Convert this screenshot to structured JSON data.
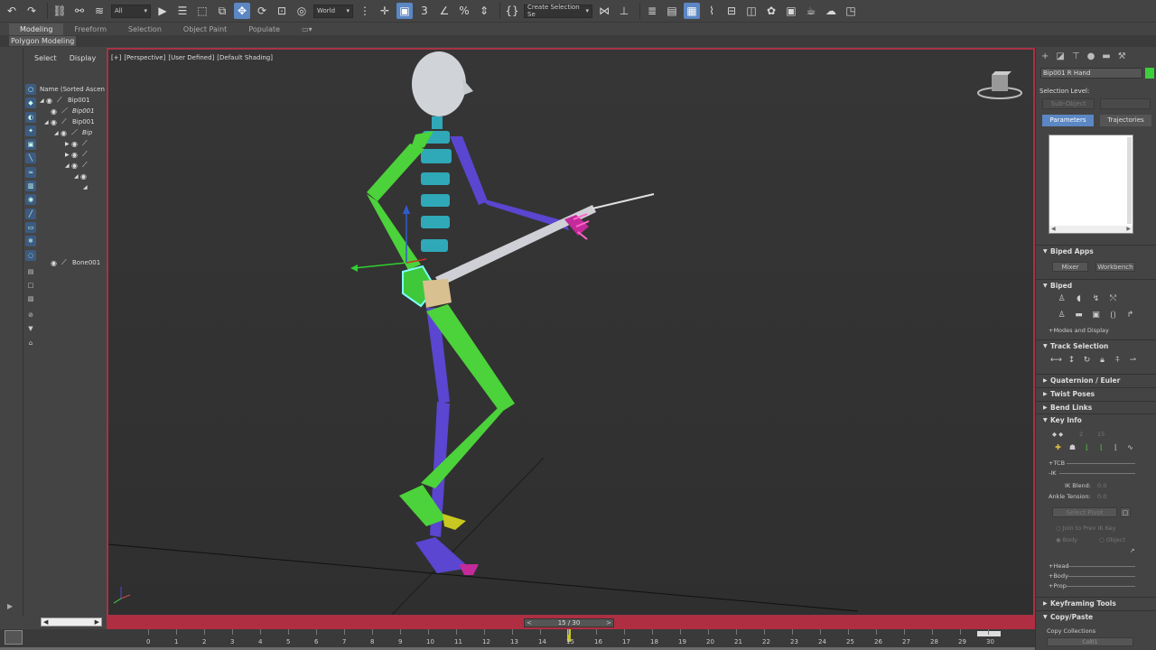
{
  "toolbar": {
    "filter_dropdown": "All",
    "coord_dropdown": "World",
    "selection_set_dropdown": "Create Selection Se"
  },
  "ribbon": {
    "tabs": [
      "Modeling",
      "Freeform",
      "Selection",
      "Object Paint",
      "Populate"
    ],
    "sub_label": "Polygon Modeling"
  },
  "explorer": {
    "tabs": [
      "Select",
      "Display"
    ],
    "header": "Name (Sorted Ascen",
    "items": [
      {
        "label": "Bip001",
        "italic": false
      },
      {
        "label": "Bip001",
        "italic": true
      },
      {
        "label": "Bip001",
        "italic": false
      },
      {
        "label": "Bip",
        "italic": true
      },
      {
        "label": "",
        "italic": false
      },
      {
        "label": "",
        "italic": false
      },
      {
        "label": "",
        "italic": false
      },
      {
        "label": "",
        "italic": false
      },
      {
        "label": "",
        "italic": false
      }
    ],
    "extra_item": "Bone001"
  },
  "viewport": {
    "label_parts": [
      "[+]",
      "[Perspective]",
      "[User Defined]",
      "[Default Shading]"
    ]
  },
  "timeline": {
    "frame_display": "15 / 30",
    "ticks": [
      "0",
      "1",
      "2",
      "3",
      "4",
      "5",
      "6",
      "7",
      "8",
      "9",
      "10",
      "11",
      "12",
      "13",
      "14",
      "15",
      "16",
      "17",
      "18",
      "19",
      "20",
      "21",
      "22",
      "23",
      "24",
      "25",
      "26",
      "27",
      "28",
      "29",
      "30"
    ]
  },
  "command_panel": {
    "object_name": "Bip001 R Hand",
    "object_color": "#3ccf3c",
    "selection_level_label": "Selection Level:",
    "sub_object_label": "Sub-Object",
    "parameters_label": "Parameters",
    "trajectories_label": "Trajectories",
    "rollouts": {
      "biped_apps": "Biped Apps",
      "mixer": "Mixer",
      "workbench": "Workbench",
      "biped": "Biped",
      "modes_display": "Modes and Display",
      "track_selection": "Track Selection",
      "quaternion": "Quaternion / Euler",
      "twist_poses": "Twist Poses",
      "bend_links": "Bend Links",
      "key_info": "Key Info",
      "key_left": "2",
      "key_right": "15",
      "tcb": "TCB",
      "ik": "IK",
      "ik_blend_label": "IK Blend:",
      "ik_blend_value": "0.0",
      "ankle_tension_label": "Ankle Tension:",
      "ankle_tension_value": "0.0",
      "select_pivot": "Select Pivot",
      "join_prev": "Join to Prev IK Key",
      "body": "Body",
      "object": "Object",
      "head": "Head",
      "body2": "Body",
      "prop": "Prop",
      "keyframing_tools": "Keyframing Tools",
      "copy_paste": "Copy/Paste",
      "copy_collections": "Copy Collections",
      "col_label": "Col01"
    }
  },
  "colors": {
    "accent": "#5b87c4",
    "timeline": "#b02e42",
    "viewport_border": "#a83245",
    "biped_green": "#4cd23a",
    "biped_blue": "#5a46d0",
    "biped_cyan": "#2fa8b8"
  }
}
